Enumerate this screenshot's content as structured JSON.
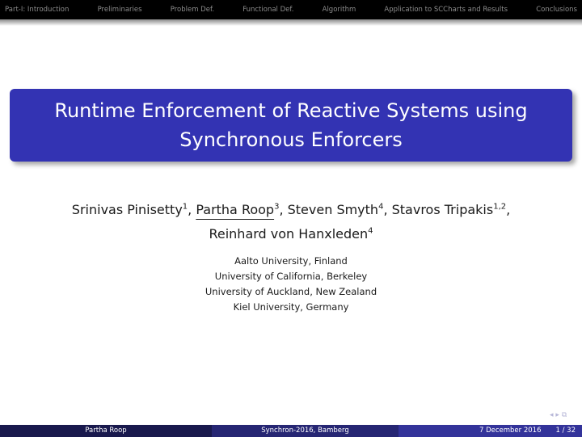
{
  "nav": {
    "items": [
      "Part-I: Introduction",
      "Preliminaries",
      "Problem Def.",
      "Functional Def.",
      "Algorithm",
      "Application to SCCharts and Results",
      "Conclusions"
    ]
  },
  "title": {
    "line1": "Runtime Enforcement of Reactive Systems using",
    "line2": "Synchronous Enforcers"
  },
  "authors": [
    {
      "name": "Srinivas Pinisetty",
      "sup": "1",
      "sep": ", "
    },
    {
      "name": "Partha Roop",
      "sup": "3",
      "sep": ", "
    },
    {
      "name": "Steven Smyth",
      "sup": "4",
      "sep": ", "
    },
    {
      "name": "Stavros Tripakis",
      "sup": "1,2",
      "sep": ","
    },
    {
      "name": "Reinhard von Hanxleden",
      "sup": "4",
      "sep": ""
    }
  ],
  "affiliations": [
    "Aalto University, Finland",
    "University of California, Berkeley",
    "University of Auckland, New Zealand",
    "Kiel University, Germany"
  ],
  "footer": {
    "presenter": "Partha Roop",
    "event": "Synchron-2016, Bamberg",
    "date": "7 December 2016",
    "page": "1 / 32"
  },
  "colors": {
    "title_bg": "#3333b3",
    "nav_bg": "#000000",
    "footer_dark": "#19194d",
    "footer_mid": "#262673",
    "footer_light": "#33339a"
  }
}
